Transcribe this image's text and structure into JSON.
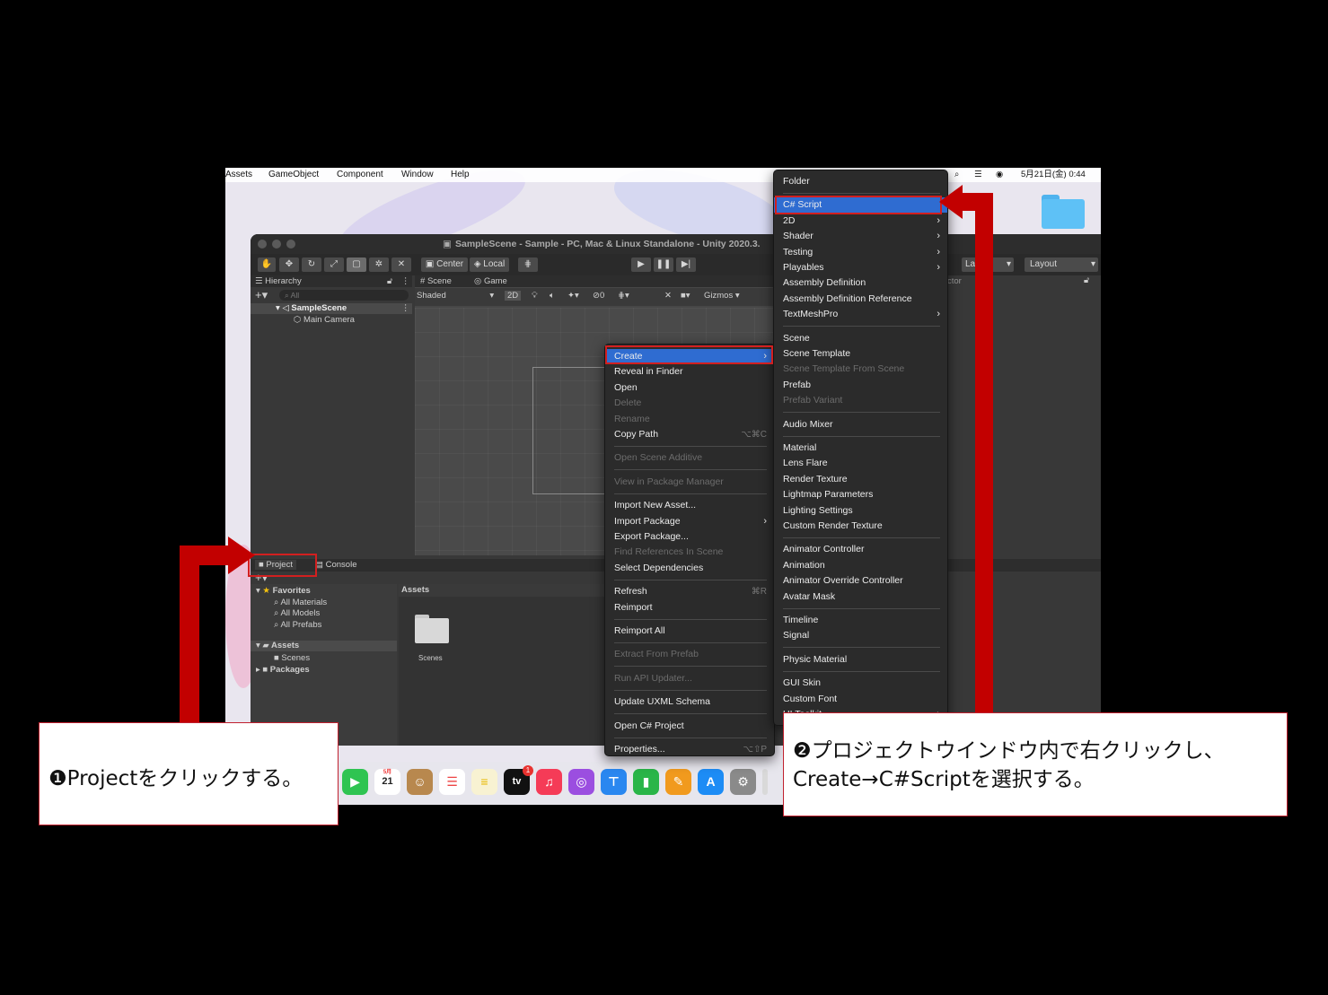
{
  "menubar": {
    "items": [
      "Assets",
      "GameObject",
      "Component",
      "Window",
      "Help"
    ],
    "clock": "5月21日(金)  0:44"
  },
  "window": {
    "title": "SampleScene - Sample - PC, Mac & Linux Standalone - Unity 2020.3.",
    "toolbar": {
      "center": "Center",
      "local": "Local",
      "layers": "La",
      "layout": "Layout"
    }
  },
  "hierarchy": {
    "tab": "Hierarchy",
    "search_placeholder": "All",
    "scene": "SampleScene",
    "items": [
      "Main Camera"
    ]
  },
  "scene_view": {
    "tabs": [
      "Scene",
      "Game"
    ],
    "shading": "Shaded",
    "mode_2d": "2D",
    "gizmos": "Gizmos",
    "counter": "0"
  },
  "inspector": {
    "tab_partial": "ctor"
  },
  "project": {
    "tabs": [
      "Project",
      "Console"
    ],
    "favorites_label": "Favorites",
    "favorites": [
      "All Materials",
      "All Models",
      "All Prefabs"
    ],
    "assets_label": "Assets",
    "assets_children": [
      "Scenes"
    ],
    "packages_label": "Packages",
    "assets_header": "Assets",
    "grid_items": [
      "Scenes"
    ]
  },
  "context_menu": [
    {
      "label": "Create",
      "submenu": true,
      "highlight": true
    },
    {
      "label": "Reveal in Finder"
    },
    {
      "label": "Open"
    },
    {
      "label": "Delete",
      "disabled": true
    },
    {
      "label": "Rename",
      "disabled": true
    },
    {
      "label": "Copy Path",
      "shortcut": "⌥⌘C"
    },
    {
      "sep": true
    },
    {
      "label": "Open Scene Additive",
      "disabled": true
    },
    {
      "sep": true
    },
    {
      "label": "View in Package Manager",
      "disabled": true
    },
    {
      "sep": true
    },
    {
      "label": "Import New Asset..."
    },
    {
      "label": "Import Package",
      "submenu": true
    },
    {
      "label": "Export Package..."
    },
    {
      "label": "Find References In Scene",
      "disabled": true
    },
    {
      "label": "Select Dependencies"
    },
    {
      "sep": true
    },
    {
      "label": "Refresh",
      "shortcut": "⌘R"
    },
    {
      "label": "Reimport"
    },
    {
      "sep": true
    },
    {
      "label": "Reimport All"
    },
    {
      "sep": true
    },
    {
      "label": "Extract From Prefab",
      "disabled": true
    },
    {
      "sep": true
    },
    {
      "label": "Run API Updater...",
      "disabled": true
    },
    {
      "sep": true
    },
    {
      "label": "Update UXML Schema"
    },
    {
      "sep": true
    },
    {
      "label": "Open C# Project"
    },
    {
      "sep": true
    },
    {
      "label": "Properties...",
      "shortcut": "⌥⇧P"
    }
  ],
  "create_submenu": [
    {
      "label": "Folder"
    },
    {
      "sep": true
    },
    {
      "label": "C# Script",
      "highlight": true
    },
    {
      "label": "2D",
      "submenu": true
    },
    {
      "label": "Shader",
      "submenu": true
    },
    {
      "label": "Testing",
      "submenu": true
    },
    {
      "label": "Playables",
      "submenu": true
    },
    {
      "label": "Assembly Definition"
    },
    {
      "label": "Assembly Definition Reference"
    },
    {
      "label": "TextMeshPro",
      "submenu": true
    },
    {
      "sep": true
    },
    {
      "label": "Scene"
    },
    {
      "label": "Scene Template"
    },
    {
      "label": "Scene Template From Scene",
      "disabled": true
    },
    {
      "label": "Prefab"
    },
    {
      "label": "Prefab Variant",
      "disabled": true
    },
    {
      "sep": true
    },
    {
      "label": "Audio Mixer"
    },
    {
      "sep": true
    },
    {
      "label": "Material"
    },
    {
      "label": "Lens Flare"
    },
    {
      "label": "Render Texture"
    },
    {
      "label": "Lightmap Parameters"
    },
    {
      "label": "Lighting Settings"
    },
    {
      "label": "Custom Render Texture"
    },
    {
      "sep": true
    },
    {
      "label": "Animator Controller"
    },
    {
      "label": "Animation"
    },
    {
      "label": "Animator Override Controller"
    },
    {
      "label": "Avatar Mask"
    },
    {
      "sep": true
    },
    {
      "label": "Timeline"
    },
    {
      "label": "Signal"
    },
    {
      "sep": true
    },
    {
      "label": "Physic Material"
    },
    {
      "sep": true
    },
    {
      "label": "GUI Skin"
    },
    {
      "label": "Custom Font"
    },
    {
      "label": "UI Toolkit",
      "submenu": true
    }
  ],
  "dock": {
    "calendar_month": "5月",
    "calendar_day": "21",
    "tv_label": "tv",
    "badge": "1"
  },
  "callouts": {
    "left": "❶Projectをクリックする。",
    "right_line1": "❷プロジェクトウインドウ内で右クリックし、",
    "right_line2": "Create→C#Scriptを選択する。"
  },
  "colors": {
    "annotation_red": "#c20000",
    "menu_highlight": "#2f6cd1"
  }
}
